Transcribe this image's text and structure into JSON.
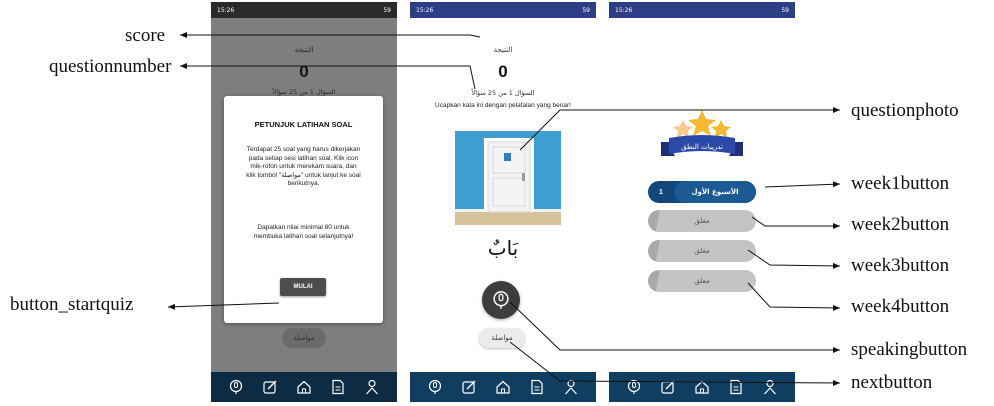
{
  "status_bar": {
    "time": "15:26",
    "battery": "59"
  },
  "phone1": {
    "score_label": "النتيجة",
    "score_value": "0",
    "question_number": "السؤال 1 من 25 سؤالاً",
    "dialog": {
      "title": "PETUNJUK LATIHAN SOAL",
      "body": "Terdapat 25 soal yang harus dikerjakan pada setiap sesi latihan soal. Klik icon mik-rofon untuk merekam suara, dan klik tombol \"مواصلة\" untuk lanjut ke soal berikutnya.",
      "body2": "Dapatkan nilai minimal 80 untuk membuka latihan soal selanjutnya!",
      "button": "MULAI"
    },
    "next_label": "مواصلة"
  },
  "phone2": {
    "score_label": "النتيجة",
    "score_value": "0",
    "question_number": "السؤال 1 من 25 سؤالاً",
    "instruction": "Ucapkan kata ini dengan pelafalan yang benar!",
    "word": "بَابٌ",
    "next_label": "مواصلة"
  },
  "phone3": {
    "badge_label": "تدريبات النطق",
    "weeks": [
      {
        "number": "1",
        "label": "الأسبوع الأول"
      },
      {
        "label": "مغلق"
      },
      {
        "label": "مغلق"
      },
      {
        "label": "مغلق"
      }
    ]
  },
  "annotations": {
    "score": "score",
    "questionnumber": "questionnumber",
    "button_startquiz": "button_startquiz",
    "questionphoto": "questionphoto",
    "week1button": "week1button",
    "week2button": "week2button",
    "week3button": "week3button",
    "week4button": "week4button",
    "speakingbutton": "speakingbutton",
    "nextbutton": "nextbutton"
  },
  "colors": {
    "nav_dark": "#0f3e60",
    "status_blue": "#2c3f86",
    "week_active": "#12467a",
    "week_locked": "#b7b7b7",
    "sky": "#3f9ed0"
  },
  "icons": [
    "microphone-icon",
    "edit-icon",
    "home-icon",
    "document-icon",
    "person-icon"
  ]
}
